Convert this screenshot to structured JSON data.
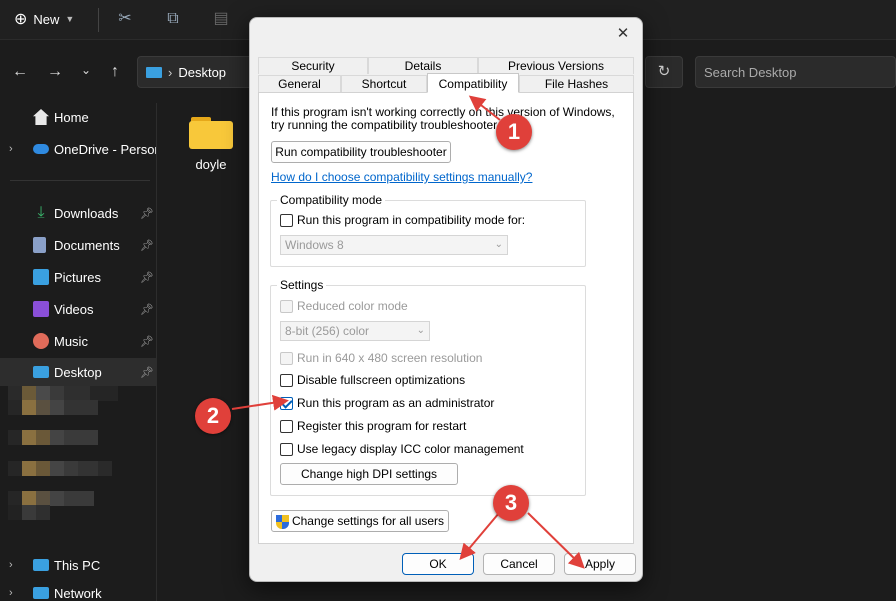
{
  "toolbar": {
    "new_label": "New"
  },
  "nav": {
    "location": "Desktop",
    "search_placeholder": "Search Desktop"
  },
  "sidebar": {
    "home": "Home",
    "onedrive": "OneDrive - Persona",
    "quick": [
      {
        "label": "Downloads",
        "icon": "download-icon",
        "color": "#3ab36b"
      },
      {
        "label": "Documents",
        "icon": "document-icon",
        "color": "#8aa0c8"
      },
      {
        "label": "Pictures",
        "icon": "pictures-icon",
        "color": "#3aa0e0"
      },
      {
        "label": "Videos",
        "icon": "videos-icon",
        "color": "#8a4fd8"
      },
      {
        "label": "Music",
        "icon": "music-icon",
        "color": "#e06b5a"
      },
      {
        "label": "Desktop",
        "icon": "desktop-icon",
        "color": "#3aa0e0"
      }
    ],
    "this_pc": "This PC",
    "network": "Network"
  },
  "files": [
    {
      "name": "doyle",
      "icon": "folder-icon"
    }
  ],
  "dialog": {
    "tabs_row1": [
      "Security",
      "Details",
      "Previous Versions"
    ],
    "tabs_row2": [
      "General",
      "Shortcut",
      "Compatibility",
      "File Hashes"
    ],
    "active_tab": "Compatibility",
    "intro_line1": "If this program isn't working correctly on this version of Windows,",
    "intro_line2": "try running the compatibility troubleshooter.",
    "troubleshooter_button": "Run compatibility troubleshooter",
    "manual_link": "How do I choose compatibility settings manually?",
    "compat_mode": {
      "title": "Compatibility mode",
      "checkbox": "Run this program in compatibility mode for:",
      "checked": false,
      "os_value": "Windows 8"
    },
    "settings": {
      "title": "Settings",
      "reduced_color": "Reduced color mode",
      "color_value": "8-bit (256) color",
      "run_640": "Run in 640 x 480 screen resolution",
      "disable_fullscreen": "Disable fullscreen optimizations",
      "run_admin": "Run this program as an administrator",
      "run_admin_checked": true,
      "register_restart": "Register this program for restart",
      "legacy_icc": "Use legacy display ICC color management",
      "high_dpi_button": "Change high DPI settings"
    },
    "all_users_button": "Change settings for all users",
    "ok": "OK",
    "cancel": "Cancel",
    "apply": "Apply"
  },
  "annotations": {
    "badge1": "1",
    "badge2": "2",
    "badge3": "3",
    "color": "#e0403a"
  }
}
